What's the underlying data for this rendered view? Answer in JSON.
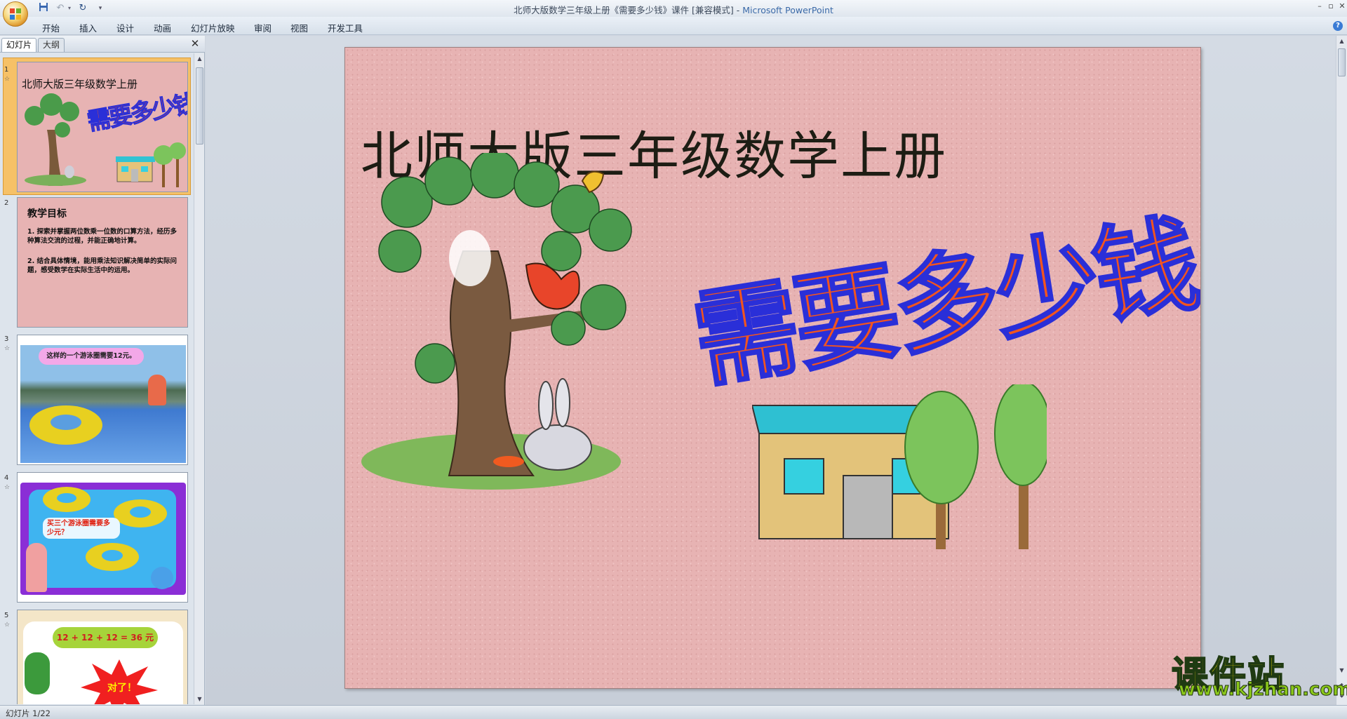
{
  "window": {
    "title": "北师大版数学三年级上册《需要多少钱》课件 [兼容模式] - ",
    "app": "Microsoft PowerPoint"
  },
  "quick_access": {
    "icons": [
      "save-icon",
      "undo-icon",
      "redo-icon",
      "customize-icon"
    ]
  },
  "ribbon": {
    "tabs": [
      "开始",
      "插入",
      "设计",
      "动画",
      "幻灯片放映",
      "审阅",
      "视图",
      "开发工具"
    ]
  },
  "left_pane": {
    "tabs": [
      "幻灯片",
      "大纲"
    ],
    "thumbnails": [
      {
        "num": "1",
        "title": "北师大版三年级数学上册",
        "big": "需要多少钱"
      },
      {
        "num": "2",
        "heading": "教学目标",
        "items": [
          "探索并掌握两位数乘一位数的口算方法，经历多种算法交流的过程，并能正确地计算。",
          "结合具体情境，能用乘法知识解决简单的实际问题，感受数学在实际生活中的运用。"
        ]
      },
      {
        "num": "3",
        "bubble": "这样的一个游泳圈需要12元。"
      },
      {
        "num": "4",
        "bubble": "买三个游泳圈需要多少元？"
      },
      {
        "num": "5",
        "equation": "12 + 12 + 12 = 36 元",
        "burst": "对了！"
      }
    ]
  },
  "slide": {
    "subtitle": "北师大版三年级数学上册",
    "title": "需要多少钱"
  },
  "status": {
    "text": "幻灯片 1/22"
  },
  "watermark": {
    "cn": "课件站",
    "url": "www.kjzhan.com"
  },
  "colors": {
    "slide_bg": "#e7b3b3",
    "title_fill": "#f2551e",
    "title_outline": "#2a2fd8",
    "selected_thumb": "#f6c167"
  }
}
